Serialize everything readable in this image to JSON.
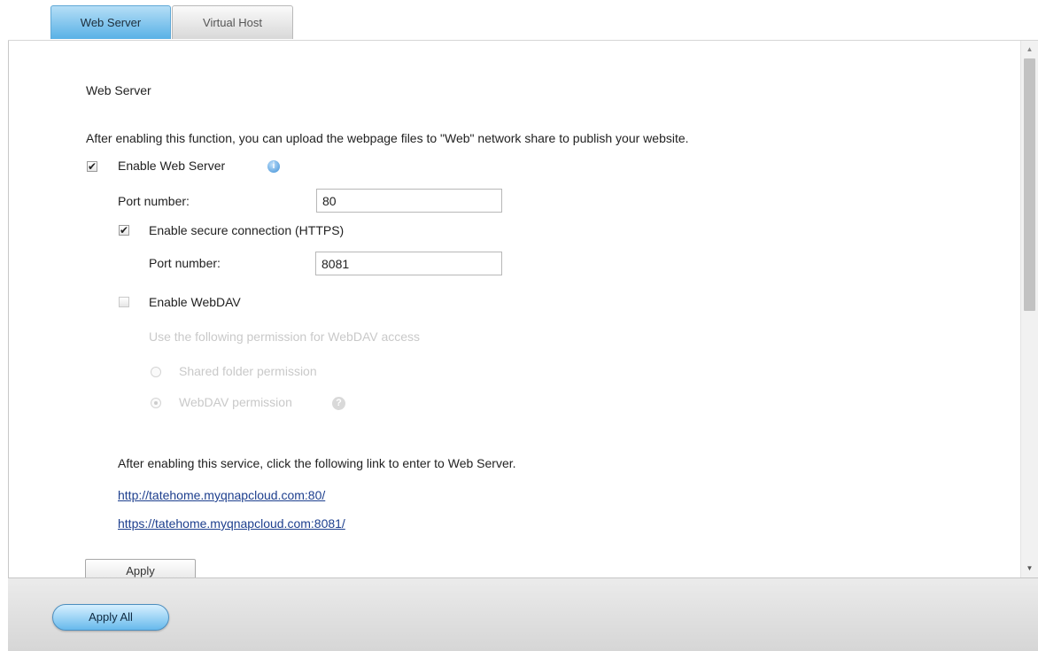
{
  "tabs": [
    {
      "label": "Web Server",
      "active": true
    },
    {
      "label": "Virtual Host",
      "active": false
    }
  ],
  "section_title": "Web Server",
  "description": "After enabling this function, you can upload the webpage files to \"Web\" network share to publish your website.",
  "web_server": {
    "enable_label": "Enable Web Server",
    "enabled": true,
    "port_label": "Port number:",
    "port_value": "80",
    "info_icon": "info-icon"
  },
  "https": {
    "enable_label": "Enable secure connection (HTTPS)",
    "enabled": true,
    "port_label": "Port number:",
    "port_value": "8081"
  },
  "webdav": {
    "enable_label": "Enable WebDAV",
    "enabled": false,
    "permission_heading": "Use the following permission for WebDAV access",
    "options": [
      {
        "label": "Shared folder permission",
        "selected": false
      },
      {
        "label": "WebDAV permission",
        "selected": true
      }
    ],
    "help_icon": "help-icon"
  },
  "links_intro": "After enabling this service, click the following link to enter to Web Server.",
  "links": [
    "http://tatehome.myqnapcloud.com:80/",
    "https://tatehome.myqnapcloud.com:8081/"
  ],
  "apply_label": "Apply",
  "apply_all_label": "Apply All",
  "colors": {
    "active_tab": "#58b1e6",
    "link": "#1d3f8e",
    "disabled_text": "#c9c9c9",
    "apply_all": "#67b9ec"
  }
}
